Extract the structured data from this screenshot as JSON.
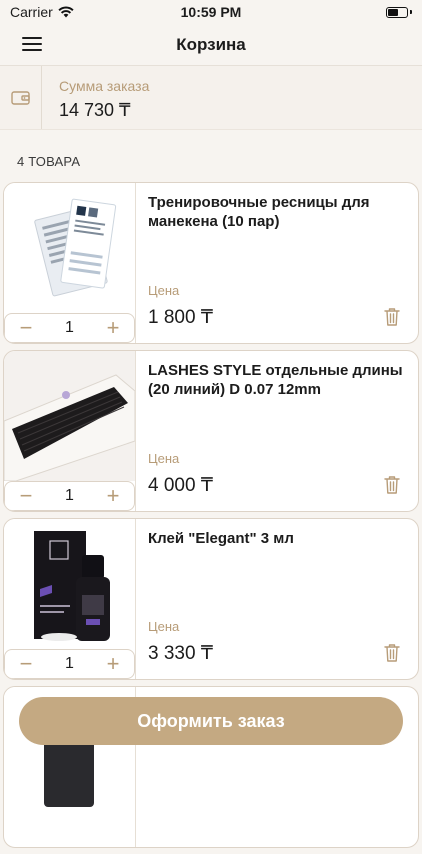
{
  "status": {
    "carrier": "Carrier",
    "time": "10:59 PM"
  },
  "nav": {
    "title": "Корзина"
  },
  "summary": {
    "label": "Сумма заказа",
    "value": "14 730 ₸"
  },
  "count_label": "4 ТОВАРА",
  "cart": {
    "items": [
      {
        "name": "Тренировочные ресницы для манекена (10 пар)",
        "price_label": "Цена",
        "price": "1 800 ₸",
        "qty": "1",
        "image": "training-lashes-card"
      },
      {
        "name": "LASHES STYLE отдельные длины (20 линий) D 0.07 12mm",
        "price_label": "Цена",
        "price": "4 000 ₸",
        "qty": "1",
        "image": "lash-tray"
      },
      {
        "name": "Клей \"Elegant\" 3 мл",
        "price_label": "Цена",
        "price": "3 330 ₸",
        "qty": "1",
        "image": "glue-bottle"
      }
    ]
  },
  "icons": {
    "wallet": "wallet-icon",
    "menu": "menu-icon",
    "trash": "trash-icon",
    "minus": "minus-icon",
    "plus": "plus-icon"
  },
  "colors": {
    "accent": "#c4a982",
    "accent_text": "#b79c78",
    "background": "#f7f4f0"
  },
  "checkout_label": "Оформить заказ"
}
